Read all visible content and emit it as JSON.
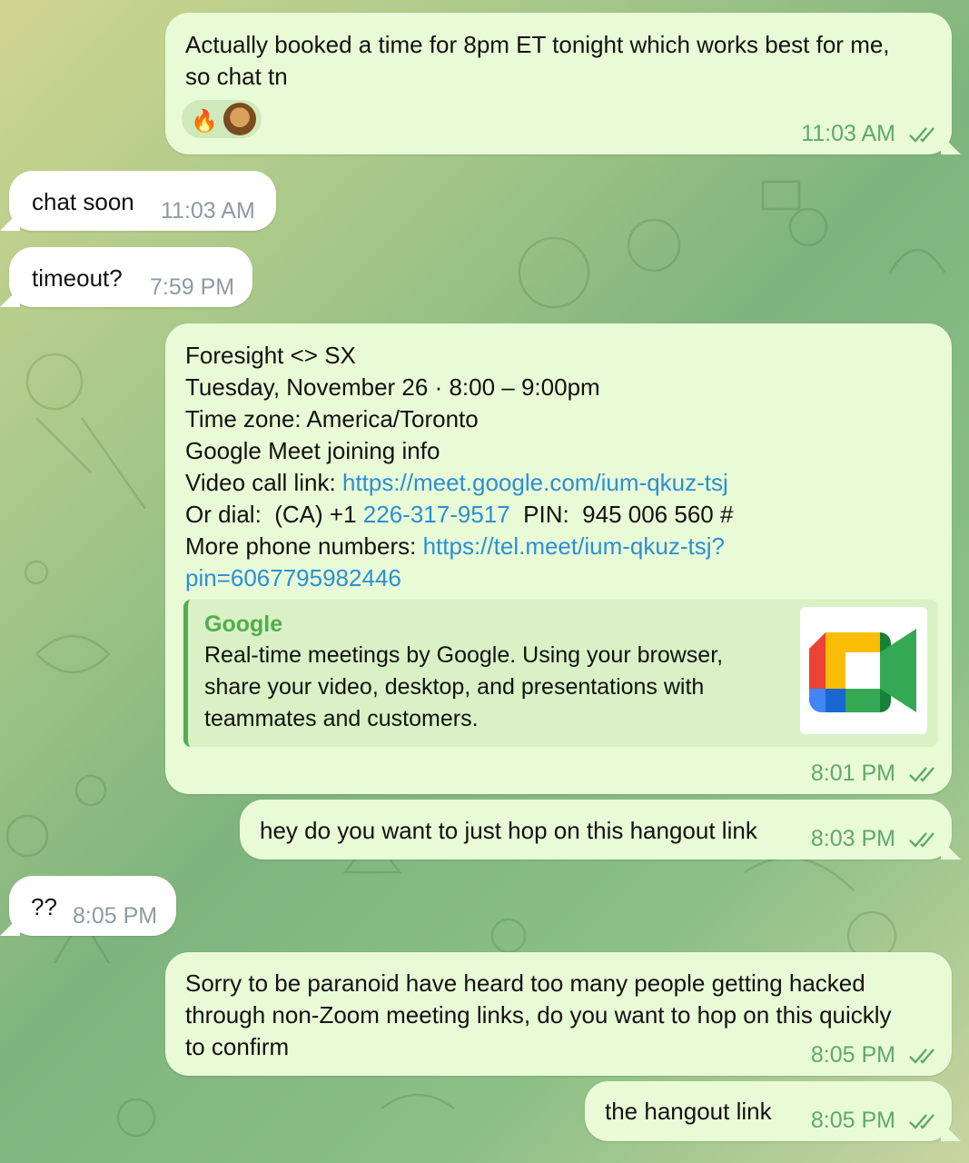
{
  "messages": {
    "m1": {
      "text_line1": "Actually booked a time for 8pm ET tonight which works best for me,",
      "text_line2": "so chat tn",
      "time": "11:03 AM",
      "reaction_emoji": "🔥"
    },
    "m2": {
      "text": "chat soon",
      "time": "11:03 AM"
    },
    "m3": {
      "text": "timeout?",
      "time": "7:59 PM"
    },
    "m4": {
      "line1": "Foresight <> SX",
      "line2": "Tuesday, November 26 · 8:00 – 9:00pm",
      "line3": "Time zone: America/Toronto",
      "line4": "Google Meet joining info",
      "line5_prefix": "Video call link: ",
      "line5_link": "https://meet.google.com/ium-qkuz-tsj",
      "line6_prefix": "Or dial:  (CA) +1 ",
      "line6_link": "226-317-9517",
      "line6_suffix": "  PIN:  945 006 560 #",
      "line7_prefix": "More phone numbers: ",
      "line7_link": "https://tel.meet/ium-qkuz-tsj?",
      "line8_link": "pin=6067795982446",
      "preview_title": "Google",
      "preview_text": "Real-time meetings by Google. Using your browser, share your video, desktop, and presentations with teammates and customers.",
      "time": "8:01 PM"
    },
    "m5": {
      "text": "hey do you want to just hop on this hangout link",
      "time": "8:03 PM"
    },
    "m6": {
      "text": "??",
      "time": "8:05 PM"
    },
    "m7": {
      "line1": "Sorry to be paranoid have heard too many people getting hacked",
      "line2": "through non-Zoom meeting links, do you want to hop on this quickly",
      "line3": "to confirm",
      "time": "8:05 PM"
    },
    "m8": {
      "text": "the hangout link",
      "time": "8:05 PM"
    }
  },
  "colors": {
    "outgoing_bubble": "#e8fbd6",
    "incoming_bubble": "#ffffff",
    "link": "#2b8fd6",
    "accent_green": "#4fae4e"
  },
  "icons": {
    "read_receipt": "double-check-icon",
    "meet_logo": "google-meet-icon"
  }
}
